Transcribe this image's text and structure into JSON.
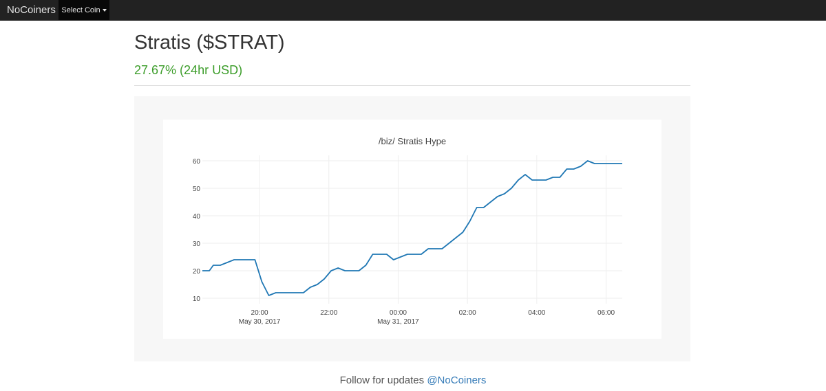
{
  "navbar": {
    "brand": "NoCoiners",
    "select_coin_label": "Select Coin"
  },
  "header": {
    "title": "Stratis ($STRAT)",
    "change": "27.67% (24hr USD)"
  },
  "colors": {
    "accent_green": "#3c9d2a",
    "line": "#1f77b4",
    "link": "#337ab7"
  },
  "chart_data": {
    "type": "line",
    "title": "/biz/ Stratis Hype",
    "xlabel": "",
    "ylabel": "",
    "grid": true,
    "legend": "none",
    "ylim": [
      8,
      62
    ],
    "xlim": [
      "2017-05-30 18:21",
      "2017-05-31 06:28"
    ],
    "yticks": [
      10,
      20,
      30,
      40,
      50,
      60
    ],
    "xticks": [
      {
        "t": "2017-05-30 20:00",
        "label": "20:00",
        "sublabel": "May 30, 2017"
      },
      {
        "t": "2017-05-30 22:00",
        "label": "22:00",
        "sublabel": ""
      },
      {
        "t": "2017-05-31 00:00",
        "label": "00:00",
        "sublabel": "May 31, 2017"
      },
      {
        "t": "2017-05-31 02:00",
        "label": "02:00",
        "sublabel": ""
      },
      {
        "t": "2017-05-31 04:00",
        "label": "04:00",
        "sublabel": ""
      },
      {
        "t": "2017-05-31 06:00",
        "label": "06:00",
        "sublabel": ""
      }
    ],
    "series": [
      {
        "x": [
          "2017-05-30 18:21",
          "2017-05-30 18:33",
          "2017-05-30 18:40",
          "2017-05-30 18:52",
          "2017-05-30 19:04",
          "2017-05-30 19:16",
          "2017-05-30 19:28",
          "2017-05-30 19:40",
          "2017-05-30 19:52",
          "2017-05-30 20:04",
          "2017-05-30 20:16",
          "2017-05-30 20:28",
          "2017-05-30 20:40",
          "2017-05-30 20:52",
          "2017-05-30 21:04",
          "2017-05-30 21:16",
          "2017-05-30 21:28",
          "2017-05-30 21:40",
          "2017-05-30 21:52",
          "2017-05-30 22:04",
          "2017-05-30 22:16",
          "2017-05-30 22:28",
          "2017-05-30 22:40",
          "2017-05-30 22:52",
          "2017-05-30 23:04",
          "2017-05-30 23:16",
          "2017-05-30 23:28",
          "2017-05-30 23:40",
          "2017-05-30 23:52",
          "2017-05-31 00:04",
          "2017-05-31 00:16",
          "2017-05-31 00:28",
          "2017-05-31 00:40",
          "2017-05-31 00:52",
          "2017-05-31 01:04",
          "2017-05-31 01:16",
          "2017-05-31 01:28",
          "2017-05-31 01:40",
          "2017-05-31 01:52",
          "2017-05-31 02:04",
          "2017-05-31 02:16",
          "2017-05-31 02:28",
          "2017-05-31 02:40",
          "2017-05-31 02:52",
          "2017-05-31 03:04",
          "2017-05-31 03:16",
          "2017-05-31 03:28",
          "2017-05-31 03:40",
          "2017-05-31 03:52",
          "2017-05-31 04:04",
          "2017-05-31 04:16",
          "2017-05-31 04:28",
          "2017-05-31 04:40",
          "2017-05-31 04:52",
          "2017-05-31 05:04",
          "2017-05-31 05:16",
          "2017-05-31 05:28",
          "2017-05-31 05:40",
          "2017-05-31 05:52",
          "2017-05-31 06:04",
          "2017-05-31 06:16",
          "2017-05-31 06:28"
        ],
        "y": [
          20,
          20,
          22,
          22,
          23,
          24,
          24,
          24,
          24,
          16,
          11,
          12,
          12,
          12,
          12,
          12,
          14,
          15,
          17,
          20,
          21,
          20,
          20,
          20,
          22,
          26,
          26,
          26,
          24,
          25,
          26,
          26,
          26,
          28,
          28,
          28,
          30,
          32,
          34,
          38,
          43,
          43,
          45,
          47,
          48,
          50,
          53,
          55,
          53,
          53,
          53,
          54,
          54,
          57,
          57,
          58,
          60,
          59,
          59,
          59,
          59,
          59
        ]
      }
    ]
  },
  "footer": {
    "text": "Follow for updates",
    "handle": "@NoCoiners"
  }
}
